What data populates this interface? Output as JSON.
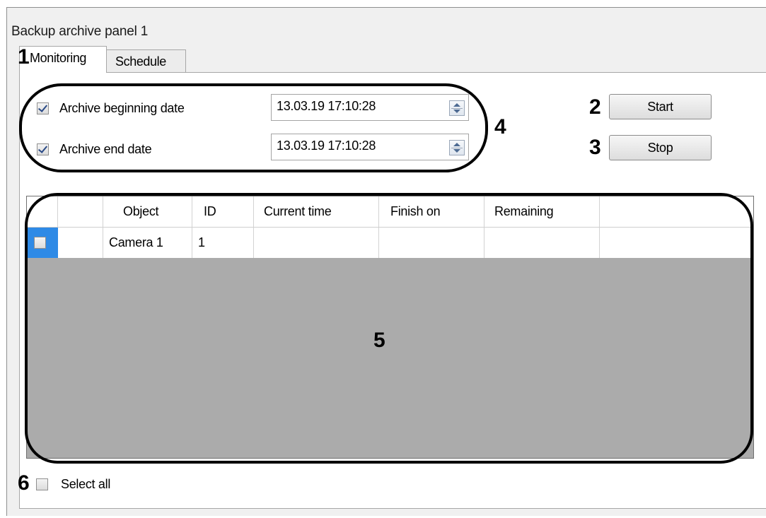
{
  "window": {
    "title": "Backup archive panel 1"
  },
  "tabs": [
    {
      "label": "Monitoring",
      "active": true
    },
    {
      "label": "Schedule",
      "active": false
    }
  ],
  "callouts": {
    "c1": "1",
    "c2": "2",
    "c3": "3",
    "c4": "4",
    "c5": "5",
    "c6": "6"
  },
  "dates": {
    "begin": {
      "label": "Archive beginning date",
      "checked": true,
      "value": "13.03.19 17:10:28"
    },
    "end": {
      "label": "Archive end date",
      "checked": true,
      "value": "13.03.19 17:10:28"
    }
  },
  "buttons": {
    "start": "Start",
    "stop": "Stop"
  },
  "table": {
    "columns": [
      "",
      "",
      "Object",
      "ID",
      "Current time",
      "Finish on",
      "Remaining",
      ""
    ],
    "rows": [
      {
        "checked": false,
        "object": "Camera 1",
        "id": "1",
        "current_time": "",
        "finish_on": "",
        "remaining": ""
      }
    ]
  },
  "select_all": {
    "label": "Select all",
    "checked": false
  },
  "icons": [
    "checkbox-icon",
    "spin-up-icon",
    "spin-down-icon"
  ],
  "colors": {
    "selection": "#2e8ae6",
    "grid_empty": "#ababab",
    "window_bg": "#f0f0f0"
  }
}
